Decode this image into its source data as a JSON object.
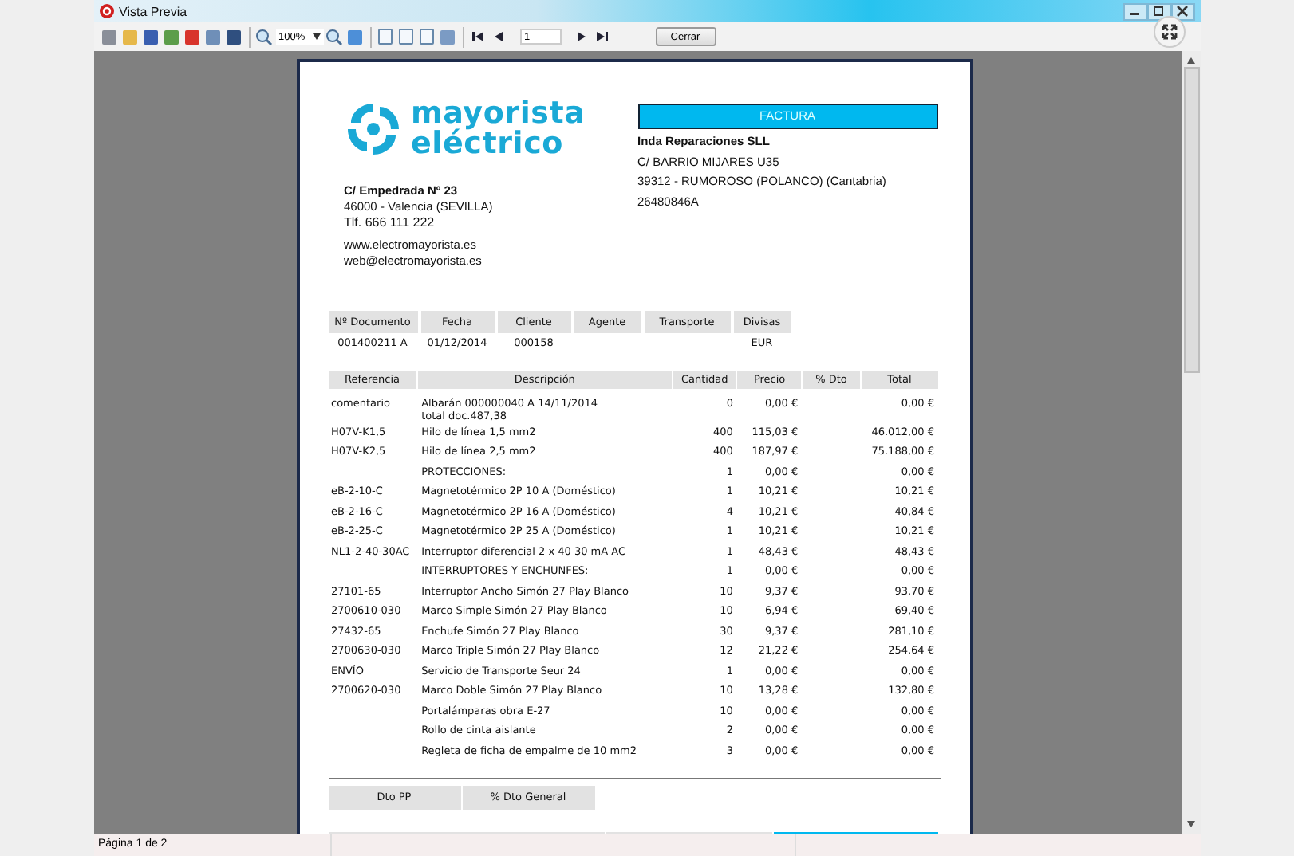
{
  "window": {
    "title": "Vista Previa"
  },
  "toolbar": {
    "zoom": "100%",
    "page": "1",
    "close_button": "Cerrar"
  },
  "document": {
    "logo": [
      "mayorista",
      "eléctrico"
    ],
    "company": {
      "street": "C/ Empedrada Nº 23",
      "city": "46000 - Valencia (SEVILLA)",
      "phone": "Tlf. 666 111 222",
      "web": "www.electromayorista.es",
      "email": "web@electromayorista.es"
    },
    "invoice_title": "FACTURA",
    "customer": {
      "name": "Inda Reparaciones SLL",
      "street": "C/ BARRIO MIJARES U35",
      "city": "39312 - RUMOROSO (POLANCO) (Cantabria)",
      "tax_id": "26480846A"
    },
    "doc_header": [
      {
        "label": "Nº Documento",
        "value": "001400211 A"
      },
      {
        "label": "Fecha",
        "value": "01/12/2014"
      },
      {
        "label": "Cliente",
        "value": "000158"
      },
      {
        "label": "Agente"
      },
      {
        "label": "Transporte"
      },
      {
        "label": "Divisas",
        "value": "EUR"
      }
    ],
    "items": {
      "columns": [
        "Referencia",
        "Descripción",
        "Cantidad",
        "Precio",
        "% Dto",
        "Total"
      ],
      "rows": [
        {
          "ref": "comentario",
          "description": "Albarán 000000040 A 14/11/2014",
          "note": "total doc.487,38",
          "qty": "0",
          "price": "0,00 €",
          "total": "0,00 €"
        },
        {
          "ref": "H07V-K1,5",
          "description": "Hilo de línea 1,5 mm2",
          "qty": "400",
          "price": "115,03 €",
          "total": "46.012,00 €"
        },
        {
          "ref": "H07V-K2,5",
          "description": "Hilo de línea 2,5 mm2",
          "qty": "400",
          "price": "187,97 €",
          "total": "75.188,00 €"
        },
        {
          "description": "PROTECCIONES:",
          "qty": "1",
          "price": "0,00 €",
          "total": "0,00 €"
        },
        {
          "ref": "eB-2-10-C",
          "description": "Magnetotérmico 2P 10 A (Doméstico)",
          "qty": "1",
          "price": "10,21 €",
          "total": "10,21 €"
        },
        {
          "ref": "eB-2-16-C",
          "description": "Magnetotérmico 2P 16 A (Doméstico)",
          "qty": "4",
          "price": "10,21 €",
          "total": "40,84 €"
        },
        {
          "ref": "eB-2-25-C",
          "description": "Magnetotérmico 2P 25 A (Doméstico)",
          "qty": "1",
          "price": "10,21 €",
          "total": "10,21 €"
        },
        {
          "ref": "NL1-2-40-30AC",
          "description": "Interruptor diferencial 2 x 40 30 mA AC",
          "qty": "1",
          "price": "48,43 €",
          "total": "48,43 €"
        },
        {
          "description": "INTERRUPTORES Y ENCHUNFES:",
          "qty": "1",
          "price": "0,00 €",
          "total": "0,00 €"
        },
        {
          "ref": "27101-65",
          "description": "Interruptor Ancho Simón 27 Play Blanco",
          "qty": "10",
          "price": "9,37 €",
          "total": "93,70 €"
        },
        {
          "ref": "2700610-030",
          "description": "Marco Simple Simón 27 Play Blanco",
          "qty": "10",
          "price": "6,94 €",
          "total": "69,40 €"
        },
        {
          "ref": "27432-65",
          "description": "Enchufe  Simón 27 Play Blanco",
          "qty": "30",
          "price": "9,37 €",
          "total": "281,10 €"
        },
        {
          "ref": "2700630-030",
          "description": "Marco Triple Simón 27 Play Blanco",
          "qty": "12",
          "price": "21,22 €",
          "total": "254,64 €"
        },
        {
          "ref": "ENVÍO",
          "description": "Servicio de Transporte Seur 24",
          "qty": "1",
          "price": "0,00 €",
          "total": "0,00 €"
        },
        {
          "ref": "2700620-030",
          "description": "Marco Doble Simón 27 Play Blanco",
          "qty": "10",
          "price": "13,28 €",
          "total": "132,80 €"
        },
        {
          "description": "Portalámparas obra E-27",
          "qty": "10",
          "price": "0,00 €",
          "total": "0,00 €"
        },
        {
          "description": "Rollo de cinta aislante",
          "qty": "2",
          "price": "0,00 €",
          "total": "0,00 €"
        },
        {
          "description": "Regleta de ficha de empalme de 10 mm2",
          "qty": "3",
          "price": "0,00 €",
          "total": "0,00 €"
        }
      ]
    },
    "discount_columns": [
      "Dto PP",
      "% Dto General"
    ]
  },
  "status_bar": {
    "page_info": "Página 1 de 2"
  }
}
